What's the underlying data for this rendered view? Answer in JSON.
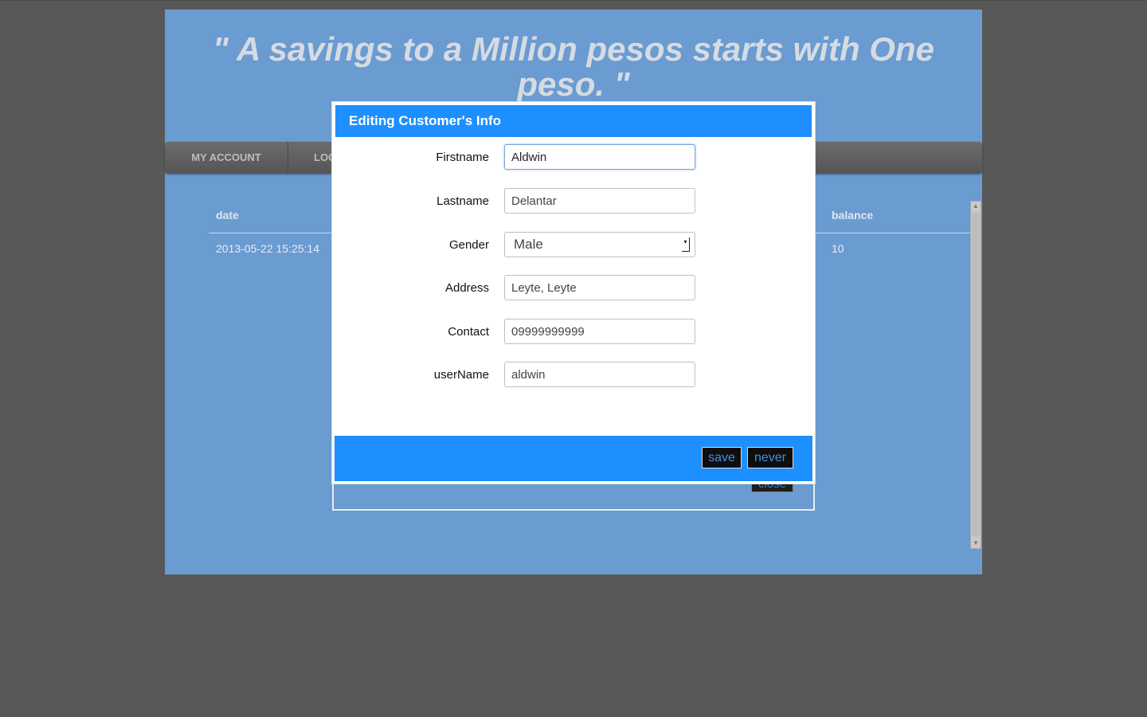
{
  "header": {
    "quote": "\" A savings to a Million pesos starts with One peso. \""
  },
  "nav": {
    "items": [
      "MY ACCOUNT",
      "LOGOUT"
    ]
  },
  "table": {
    "columns": {
      "date": "date",
      "balance": "balance"
    },
    "rows": [
      {
        "date": "2013-05-22 15:25:14",
        "balance": "10"
      }
    ]
  },
  "under_dialog": {
    "close_label": "close"
  },
  "dialog": {
    "title": "Editing Customer's Info",
    "fields": {
      "firstname": {
        "label": "Firstname",
        "value": "Aldwin"
      },
      "lastname": {
        "label": "Lastname",
        "value": "Delantar"
      },
      "gender": {
        "label": "Gender",
        "value": "Male"
      },
      "address": {
        "label": "Address",
        "value": "Leyte, Leyte"
      },
      "contact": {
        "label": "Contact",
        "value": "09999999999"
      },
      "username": {
        "label": "userName",
        "value": "aldwin"
      }
    },
    "save_label": "save",
    "never_label": "never"
  },
  "colors": {
    "page_bg": "#6a9bd1",
    "backdrop": "#585858",
    "dialog_accent": "#1e8ffe"
  }
}
